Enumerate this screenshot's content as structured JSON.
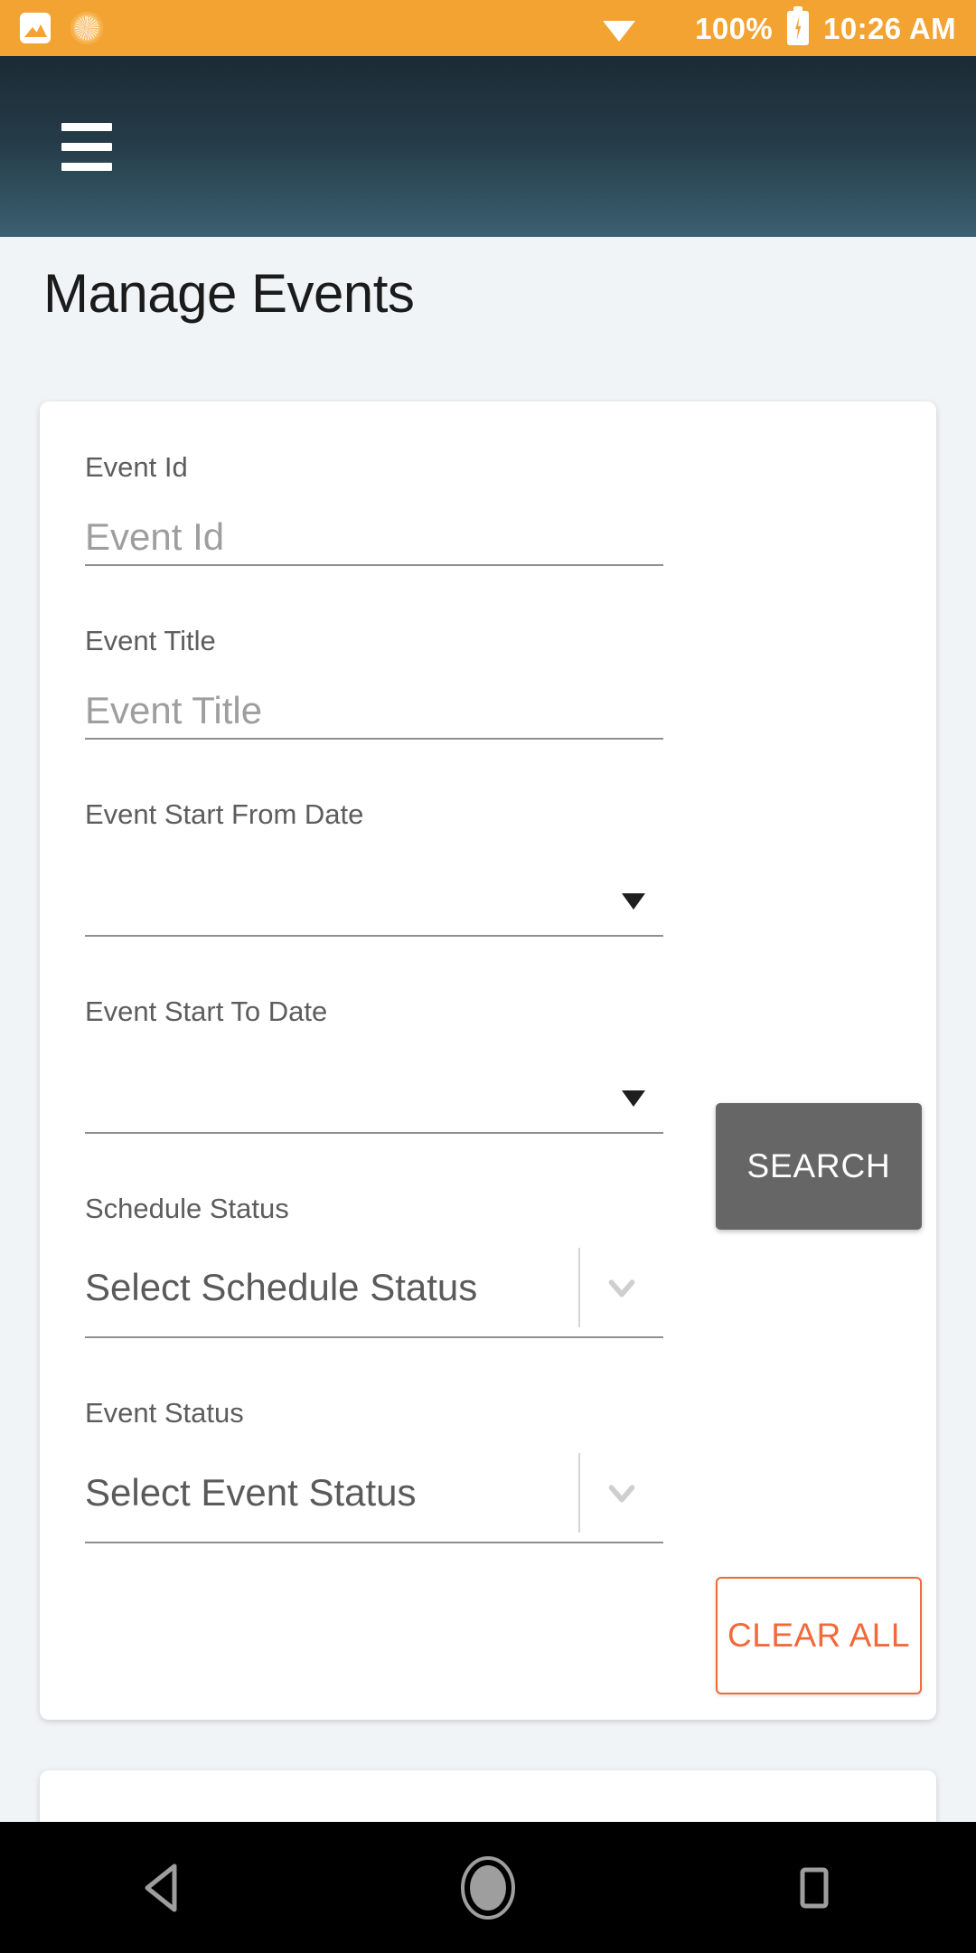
{
  "statusbar": {
    "icons_left": [
      "gallery-icon",
      "sun-icon"
    ],
    "wifi_icon": "wifi-icon",
    "sim_icon": "no-sim-icon",
    "battery_percent": "100%",
    "battery_icon": "battery-charging-icon",
    "time": "10:26 AM",
    "background": "#f2a331"
  },
  "toolbar": {
    "menu_icon": "hamburger-menu-icon",
    "gradient_from": "#1b2a35",
    "gradient_to": "#3a6072"
  },
  "page": {
    "title": "Manage Events",
    "background": "#f1f4f7"
  },
  "search_form": {
    "fields": [
      {
        "label": "Event Id",
        "placeholder": "Event Id",
        "type": "text"
      },
      {
        "label": "Event Title",
        "placeholder": "Event Title",
        "type": "text"
      },
      {
        "label": "Event Start From Date",
        "placeholder": "",
        "type": "date"
      },
      {
        "label": "Event Start To Date",
        "placeholder": "",
        "type": "date"
      },
      {
        "label": "Schedule Status",
        "value": "Select Schedule Status",
        "type": "select"
      },
      {
        "label": "Event Status",
        "value": "Select Event Status",
        "type": "select"
      }
    ],
    "search_button": "SEARCH",
    "clear_button": "CLEAR ALL",
    "search_button_color": "#666666",
    "clear_button_color": "#f2693c"
  },
  "navbar": {
    "back": "back-nav-button",
    "home": "home-nav-button",
    "recents": "recents-nav-button",
    "background": "#000000",
    "icon_color": "#9e9e9e"
  }
}
